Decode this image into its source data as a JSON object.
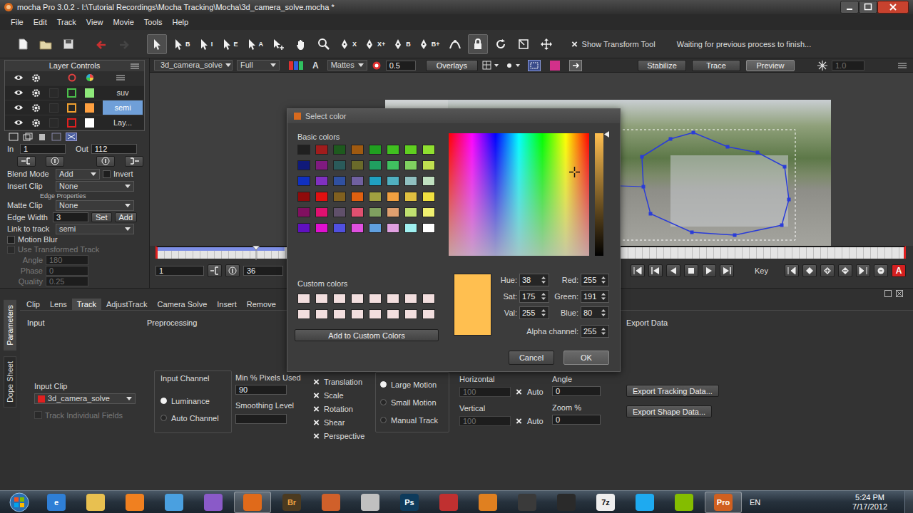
{
  "window": {
    "title": "mocha Pro 3.0.2 - I:\\Tutorial Recordings\\Mocha Tracking\\Mocha\\3d_camera_solve.mocha *"
  },
  "menu": [
    "File",
    "Edit",
    "Track",
    "View",
    "Movie",
    "Tools",
    "Help"
  ],
  "tools": [
    {
      "kind": "file",
      "selected": false,
      "disabled": false
    },
    {
      "kind": "folder",
      "selected": false,
      "disabled": false
    },
    {
      "kind": "save",
      "selected": false,
      "disabled": false
    },
    {
      "kind": "undo",
      "selected": false,
      "disabled": false
    },
    {
      "kind": "redo",
      "selected": false,
      "disabled": true
    },
    {
      "kind": "arrow",
      "selected": true,
      "disabled": false
    },
    {
      "kind": "arrow",
      "glyph": "B",
      "selected": false,
      "disabled": false
    },
    {
      "kind": "arrow",
      "glyph": "I",
      "selected": false,
      "disabled": false
    },
    {
      "kind": "arrow",
      "glyph": "E",
      "selected": false,
      "disabled": false
    },
    {
      "kind": "arrow",
      "glyph": "A",
      "selected": false,
      "disabled": false
    },
    {
      "kind": "add",
      "selected": false,
      "disabled": false
    },
    {
      "kind": "hand",
      "selected": false,
      "disabled": false
    },
    {
      "kind": "zoom",
      "selected": false,
      "disabled": false
    },
    {
      "kind": "pen",
      "glyph": "X",
      "selected": false,
      "disabled": false
    },
    {
      "kind": "pen",
      "glyph": "X+",
      "selected": false,
      "disabled": false
    },
    {
      "kind": "pen",
      "glyph": "B",
      "selected": false,
      "disabled": false
    },
    {
      "kind": "pen",
      "glyph": "B+",
      "selected": false,
      "disabled": false
    },
    {
      "kind": "curve",
      "selected": false,
      "disabled": false
    },
    {
      "kind": "lock",
      "selected": true,
      "disabled": false
    },
    {
      "kind": "rotate",
      "selected": false,
      "disabled": false
    },
    {
      "kind": "scale",
      "selected": false,
      "disabled": false
    },
    {
      "kind": "move",
      "selected": false,
      "disabled": false
    }
  ],
  "show_transform_tool": {
    "label": "Show Transform Tool",
    "checked": true
  },
  "status": "Waiting for previous process to finish...",
  "layers": {
    "title": "Layer Controls",
    "items": [
      {
        "name": "suv",
        "selected": false,
        "color": "#4cc24c",
        "swatch_color": "#8ee87a"
      },
      {
        "name": "semi",
        "selected": true,
        "color": "#f0a030",
        "swatch_color": "#ffa040"
      },
      {
        "name": "Lay...",
        "selected": false,
        "color": "#e02020",
        "swatch_color": "#ffffff"
      }
    ]
  },
  "layer_params": {
    "in": {
      "label": "In",
      "value": "1"
    },
    "out": {
      "label": "Out",
      "value": "112"
    },
    "blend": {
      "label": "Blend Mode",
      "value": "Add"
    },
    "invert": {
      "label": "Invert",
      "checked": false
    },
    "insert_clip": {
      "label": "Insert Clip",
      "value": "None"
    },
    "edge_header": "Edge Properties",
    "matte_clip": {
      "label": "Matte Clip",
      "value": "None"
    },
    "edge_width": {
      "label": "Edge Width",
      "value": "3"
    },
    "edge_buttons": [
      "Set",
      "Add"
    ],
    "link": {
      "label": "Link to track",
      "value": "semi"
    },
    "motion_blur": {
      "label": "Motion Blur",
      "checked": false,
      "disabled": false
    },
    "use_transformed": {
      "label": "Use Transformed Track",
      "checked": false,
      "disabled": true
    },
    "blur_fields": [
      {
        "label": "Angle",
        "value": "180",
        "disabled": true
      },
      {
        "label": "Phase",
        "value": "0",
        "disabled": true
      },
      {
        "label": "Quality",
        "value": "0.25",
        "disabled": true
      }
    ]
  },
  "clipbar": {
    "clip": "3d_camera_solve",
    "resolution": "Full",
    "alpha": "A",
    "mattes": "Mattes",
    "opacity": "0.5",
    "overlays": "Overlays",
    "buttons": [
      {
        "label": "Stabilize",
        "selected": false
      },
      {
        "label": "Trace",
        "selected": false
      },
      {
        "label": "Preview",
        "selected": true
      }
    ],
    "zoom": "1.0"
  },
  "timeline": {
    "playhead": 0.132,
    "tracked": 0.17,
    "start": "1",
    "current": "36",
    "track_label": "Track",
    "key_label": "Key",
    "autokey": {
      "glyph": "A",
      "on": true
    }
  },
  "side_tabs": [
    {
      "label": "Parameters",
      "selected": true
    },
    {
      "label": "Dope Sheet",
      "selected": false
    }
  ],
  "bottom_tabs": [
    {
      "label": "Clip",
      "selected": false
    },
    {
      "label": "Lens",
      "selected": false
    },
    {
      "label": "Track",
      "selected": true
    },
    {
      "label": "AdjustTrack",
      "selected": false
    },
    {
      "label": "Camera Solve",
      "selected": false
    },
    {
      "label": "Insert",
      "selected": false
    },
    {
      "label": "Remove",
      "selected": false
    }
  ],
  "track_params": {
    "input_header": "Input",
    "preprocessing_header": "Preprocessing",
    "export_header": "Export Data",
    "input_clip": {
      "label": "Input Clip",
      "value": "3d_camera_solve"
    },
    "track_fields": {
      "label": "Track Individual Fields",
      "checked": false,
      "disabled": true
    },
    "input_channel": {
      "label": "Input Channel",
      "options": [
        {
          "label": "Luminance",
          "selected": true
        },
        {
          "label": "Auto Channel",
          "selected": false
        }
      ]
    },
    "min_pixels": {
      "label": "Min % Pixels Used",
      "value": "90"
    },
    "smoothing": {
      "label": "Smoothing Level"
    },
    "motion": [
      {
        "label": "Translation",
        "checked": true
      },
      {
        "label": "Scale",
        "checked": true
      },
      {
        "label": "Rotation",
        "checked": true
      },
      {
        "label": "Shear",
        "checked": true
      },
      {
        "label": "Perspective",
        "checked": true
      }
    ],
    "motion_size": [
      {
        "label": "Large Motion",
        "selected": true
      },
      {
        "label": "Small Motion",
        "selected": false
      },
      {
        "label": "Manual Track",
        "selected": false
      }
    ],
    "search": [
      {
        "label": "Horizontal",
        "value": "100",
        "disabled": true,
        "auto": {
          "label": "Auto",
          "checked": true
        }
      },
      {
        "label": "Vertical",
        "value": "100",
        "disabled": true,
        "auto": {
          "label": "Auto",
          "checked": true
        }
      }
    ],
    "offsets": [
      {
        "label": "Angle",
        "value": "0"
      },
      {
        "label": "Zoom %",
        "value": "0"
      }
    ],
    "export_buttons": [
      "Export Tracking Data...",
      "Export Shape Data..."
    ]
  },
  "dialog": {
    "title": "Select color",
    "basic_label": "Basic colors",
    "basic": [
      {
        "color": "#202020"
      },
      {
        "color": "#a01c1c"
      },
      {
        "color": "#1e5a1e"
      },
      {
        "color": "#a05a10"
      },
      {
        "color": "#20a020"
      },
      {
        "color": "#40c020"
      },
      {
        "color": "#60d020"
      },
      {
        "color": "#90e030"
      },
      {
        "color": "#101a7a"
      },
      {
        "color": "#801a80"
      },
      {
        "color": "#2a5a5a"
      },
      {
        "color": "#6a6a2a"
      },
      {
        "color": "#20a060"
      },
      {
        "color": "#40c060"
      },
      {
        "color": "#80d060"
      },
      {
        "color": "#c0e050"
      },
      {
        "color": "#1030c0"
      },
      {
        "color": "#8030c0"
      },
      {
        "color": "#3050a0"
      },
      {
        "color": "#7060a0"
      },
      {
        "color": "#20a0c0"
      },
      {
        "color": "#50b0c0"
      },
      {
        "color": "#90c0c0"
      },
      {
        "color": "#c0e0c0"
      },
      {
        "color": "#900a0a"
      },
      {
        "color": "#e01010"
      },
      {
        "color": "#806020"
      },
      {
        "color": "#e06010"
      },
      {
        "color": "#a0a040"
      },
      {
        "color": "#f0a040"
      },
      {
        "color": "#e0c040"
      },
      {
        "color": "#f0e040"
      },
      {
        "color": "#801060"
      },
      {
        "color": "#e01070"
      },
      {
        "color": "#60506a"
      },
      {
        "color": "#e05070"
      },
      {
        "color": "#80a060"
      },
      {
        "color": "#e0a070"
      },
      {
        "color": "#c0e070"
      },
      {
        "color": "#f0f070"
      },
      {
        "color": "#6010c0"
      },
      {
        "color": "#e010d0"
      },
      {
        "color": "#5050e0"
      },
      {
        "color": "#e050e0"
      },
      {
        "color": "#60a0e0"
      },
      {
        "color": "#e0a0e0"
      },
      {
        "color": "#a0f0f0"
      },
      {
        "color": "#ffffff"
      }
    ],
    "custom_label": "Custom colors",
    "custom": [
      {
        "color": "#f2dede"
      },
      {
        "color": "#f2dede"
      },
      {
        "color": "#f2dede"
      },
      {
        "color": "#f2dede"
      },
      {
        "color": "#f2dede"
      },
      {
        "color": "#f2dede"
      },
      {
        "color": "#f2dede"
      },
      {
        "color": "#f2dede"
      },
      {
        "color": "#f2dede"
      },
      {
        "color": "#f2dede"
      },
      {
        "color": "#f2dede"
      },
      {
        "color": "#f2dede"
      },
      {
        "color": "#f2dede"
      },
      {
        "color": "#f2dede"
      },
      {
        "color": "#f2dede"
      },
      {
        "color": "#f2dede"
      }
    ],
    "add_button": "Add to Custom Colors",
    "preview_color": "#ffbf50",
    "fields": [
      {
        "label": "Hue:",
        "value": "38"
      },
      {
        "label": "Red:",
        "value": "255"
      },
      {
        "label": "Sat:",
        "value": "175"
      },
      {
        "label": "Green:",
        "value": "191"
      },
      {
        "label": "Val:",
        "value": "255"
      },
      {
        "label": "Blue:",
        "value": "80"
      }
    ],
    "alpha": {
      "label": "Alpha channel:",
      "value": "255"
    },
    "buttons": [
      {
        "label": "Cancel",
        "selected": false
      },
      {
        "label": "OK",
        "selected": true
      }
    ]
  },
  "taskbar": {
    "apps": [
      {
        "glyph": "e",
        "color": "#2f7fd6",
        "active": false
      },
      {
        "color": "#e8c050",
        "active": false
      },
      {
        "color": "#f08020",
        "active": false
      },
      {
        "color": "#4aa0e0",
        "active": false
      },
      {
        "color": "#8a5ac8",
        "active": false
      },
      {
        "color": "#e06a1a",
        "active": true
      },
      {
        "glyph": "Br",
        "color": "#4b3a20",
        "active": false
      },
      {
        "color": "#d0602a",
        "active": false
      },
      {
        "color": "#c0c0c0",
        "active": false
      },
      {
        "glyph": "Ps",
        "color": "#0e3b5c",
        "active": false
      },
      {
        "color": "#c03030",
        "active": false
      },
      {
        "color": "#e08020",
        "active": false
      },
      {
        "color": "#3a3a3a",
        "active": false
      },
      {
        "color": "#2a2a2a",
        "active": false
      },
      {
        "glyph": "7z",
        "color": "#eeeeee",
        "active": false
      },
      {
        "color": "#1eaaf0",
        "active": false
      },
      {
        "color": "#84bd00",
        "active": false
      },
      {
        "glyph": "Pro",
        "color": "#d06020",
        "active": true
      }
    ],
    "lang": "EN",
    "time": "5:24 PM",
    "date": "7/17/2012"
  }
}
